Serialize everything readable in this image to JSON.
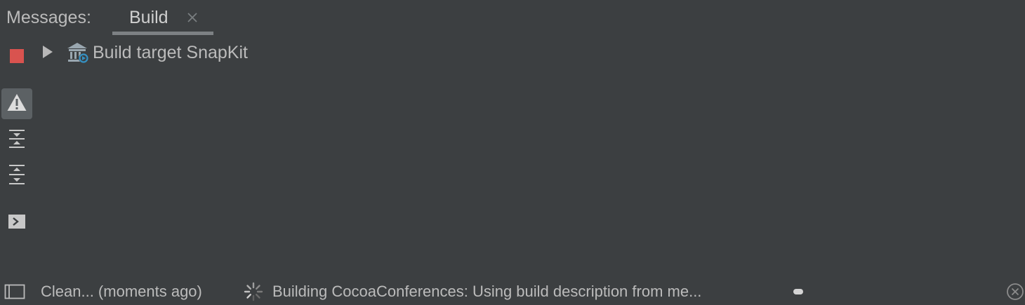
{
  "header": {
    "label": "Messages:",
    "tabs": [
      {
        "label": "Build",
        "closable": true,
        "active": true
      }
    ]
  },
  "toolbar": {
    "icons": [
      "stop-icon",
      "warning-icon",
      "collapse-all-icon",
      "expand-all-icon",
      "console-icon"
    ],
    "stop_color": "#d9534f",
    "warning_active": true
  },
  "tree": {
    "items": [
      {
        "label": "Build target SnapKit",
        "expanded": false,
        "icon": "build-target-icon"
      }
    ]
  },
  "status_bar": {
    "left_text": "Clean... (moments ago)",
    "progress_text": "Building CocoaConferences: Using build description from me...",
    "progress_fraction": 0.05
  },
  "colors": {
    "background": "#3c3f41",
    "text": "#bbbbbb",
    "accent_blue": "#3592c4"
  }
}
